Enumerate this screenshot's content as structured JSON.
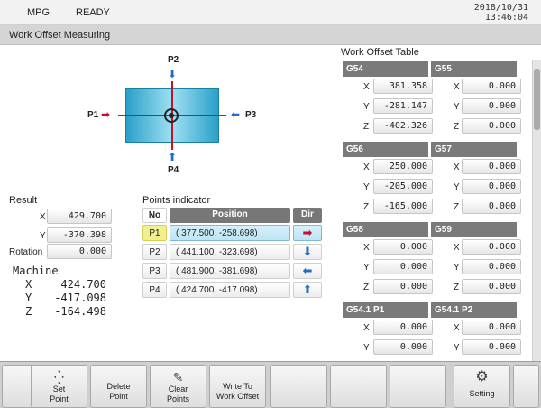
{
  "status": {
    "mode": "MPG",
    "state": "READY",
    "date": "2018/10/31",
    "time": "13:46:04"
  },
  "title": "Work Offset Measuring",
  "diagram": {
    "labels": {
      "p1": "P1",
      "p2": "P2",
      "p3": "P3",
      "p4": "P4"
    },
    "arrows": {
      "p1": "➡",
      "p2": "⬇",
      "p3": "⬅",
      "p4": "⬆"
    },
    "colors": {
      "arrow_red": "#c8102e",
      "arrow_blue": "#1f6fc0",
      "workpiece": "#2aa0c9"
    }
  },
  "result": {
    "title": "Result",
    "x_label": "X",
    "x_value": "429.700",
    "y_label": "Y",
    "y_value": "-370.398",
    "rotation_label": "Rotation",
    "rotation_value": "0.000",
    "machine": {
      "title": "Machine",
      "rows": [
        {
          "axis": "X",
          "value": "424.700"
        },
        {
          "axis": "Y",
          "value": "-417.098"
        },
        {
          "axis": "Z",
          "value": "-164.498"
        }
      ]
    }
  },
  "points": {
    "title": "Points indicator",
    "headers": {
      "no": "No",
      "position": "Position",
      "dir": "Dir"
    },
    "rows": [
      {
        "no": "P1",
        "position": "( 377.500, -258.698)",
        "dir": "➡",
        "dir_color": "#c8102e"
      },
      {
        "no": "P2",
        "position": "( 441.100, -323.698)",
        "dir": "⬇",
        "dir_color": "#1f6fc0"
      },
      {
        "no": "P3",
        "position": "( 481.900, -381.698)",
        "dir": "⬅",
        "dir_color": "#1f6fc0"
      },
      {
        "no": "P4",
        "position": "( 424.700, -417.098)",
        "dir": "⬆",
        "dir_color": "#1f6fc0"
      }
    ],
    "selected_index": 0
  },
  "offset_table": {
    "title": "Work Offset Table",
    "axes": [
      "X",
      "Y",
      "Z"
    ],
    "blocks": [
      {
        "name": "G54",
        "values": [
          "381.358",
          "-281.147",
          "-402.326"
        ]
      },
      {
        "name": "G55",
        "values": [
          "0.000",
          "0.000",
          "0.000"
        ]
      },
      {
        "name": "G56",
        "values": [
          "250.000",
          "-205.000",
          "-165.000"
        ]
      },
      {
        "name": "G57",
        "values": [
          "0.000",
          "0.000",
          "0.000"
        ]
      },
      {
        "name": "G58",
        "values": [
          "0.000",
          "0.000",
          "0.000"
        ]
      },
      {
        "name": "G59",
        "values": [
          "0.000",
          "0.000",
          "0.000"
        ]
      },
      {
        "name": "G54.1 P1",
        "values": [
          "0.000",
          "0.000",
          ""
        ]
      },
      {
        "name": "G54.1 P2",
        "values": [
          "0.000",
          "0.000",
          ""
        ]
      }
    ]
  },
  "softkeys": [
    {
      "icon": "⁛",
      "label": "Set\nPoint"
    },
    {
      "icon": "",
      "label": "Delete\nPoint"
    },
    {
      "icon": "✎",
      "label": "Clear\nPoints"
    },
    {
      "icon": "",
      "label": "Write To\nWork Offset"
    },
    {
      "icon": "",
      "label": ""
    },
    {
      "icon": "",
      "label": ""
    },
    {
      "icon": "",
      "label": ""
    },
    {
      "icon": "⚙",
      "label": "Setting"
    },
    {
      "icon": "",
      "label": ""
    }
  ]
}
